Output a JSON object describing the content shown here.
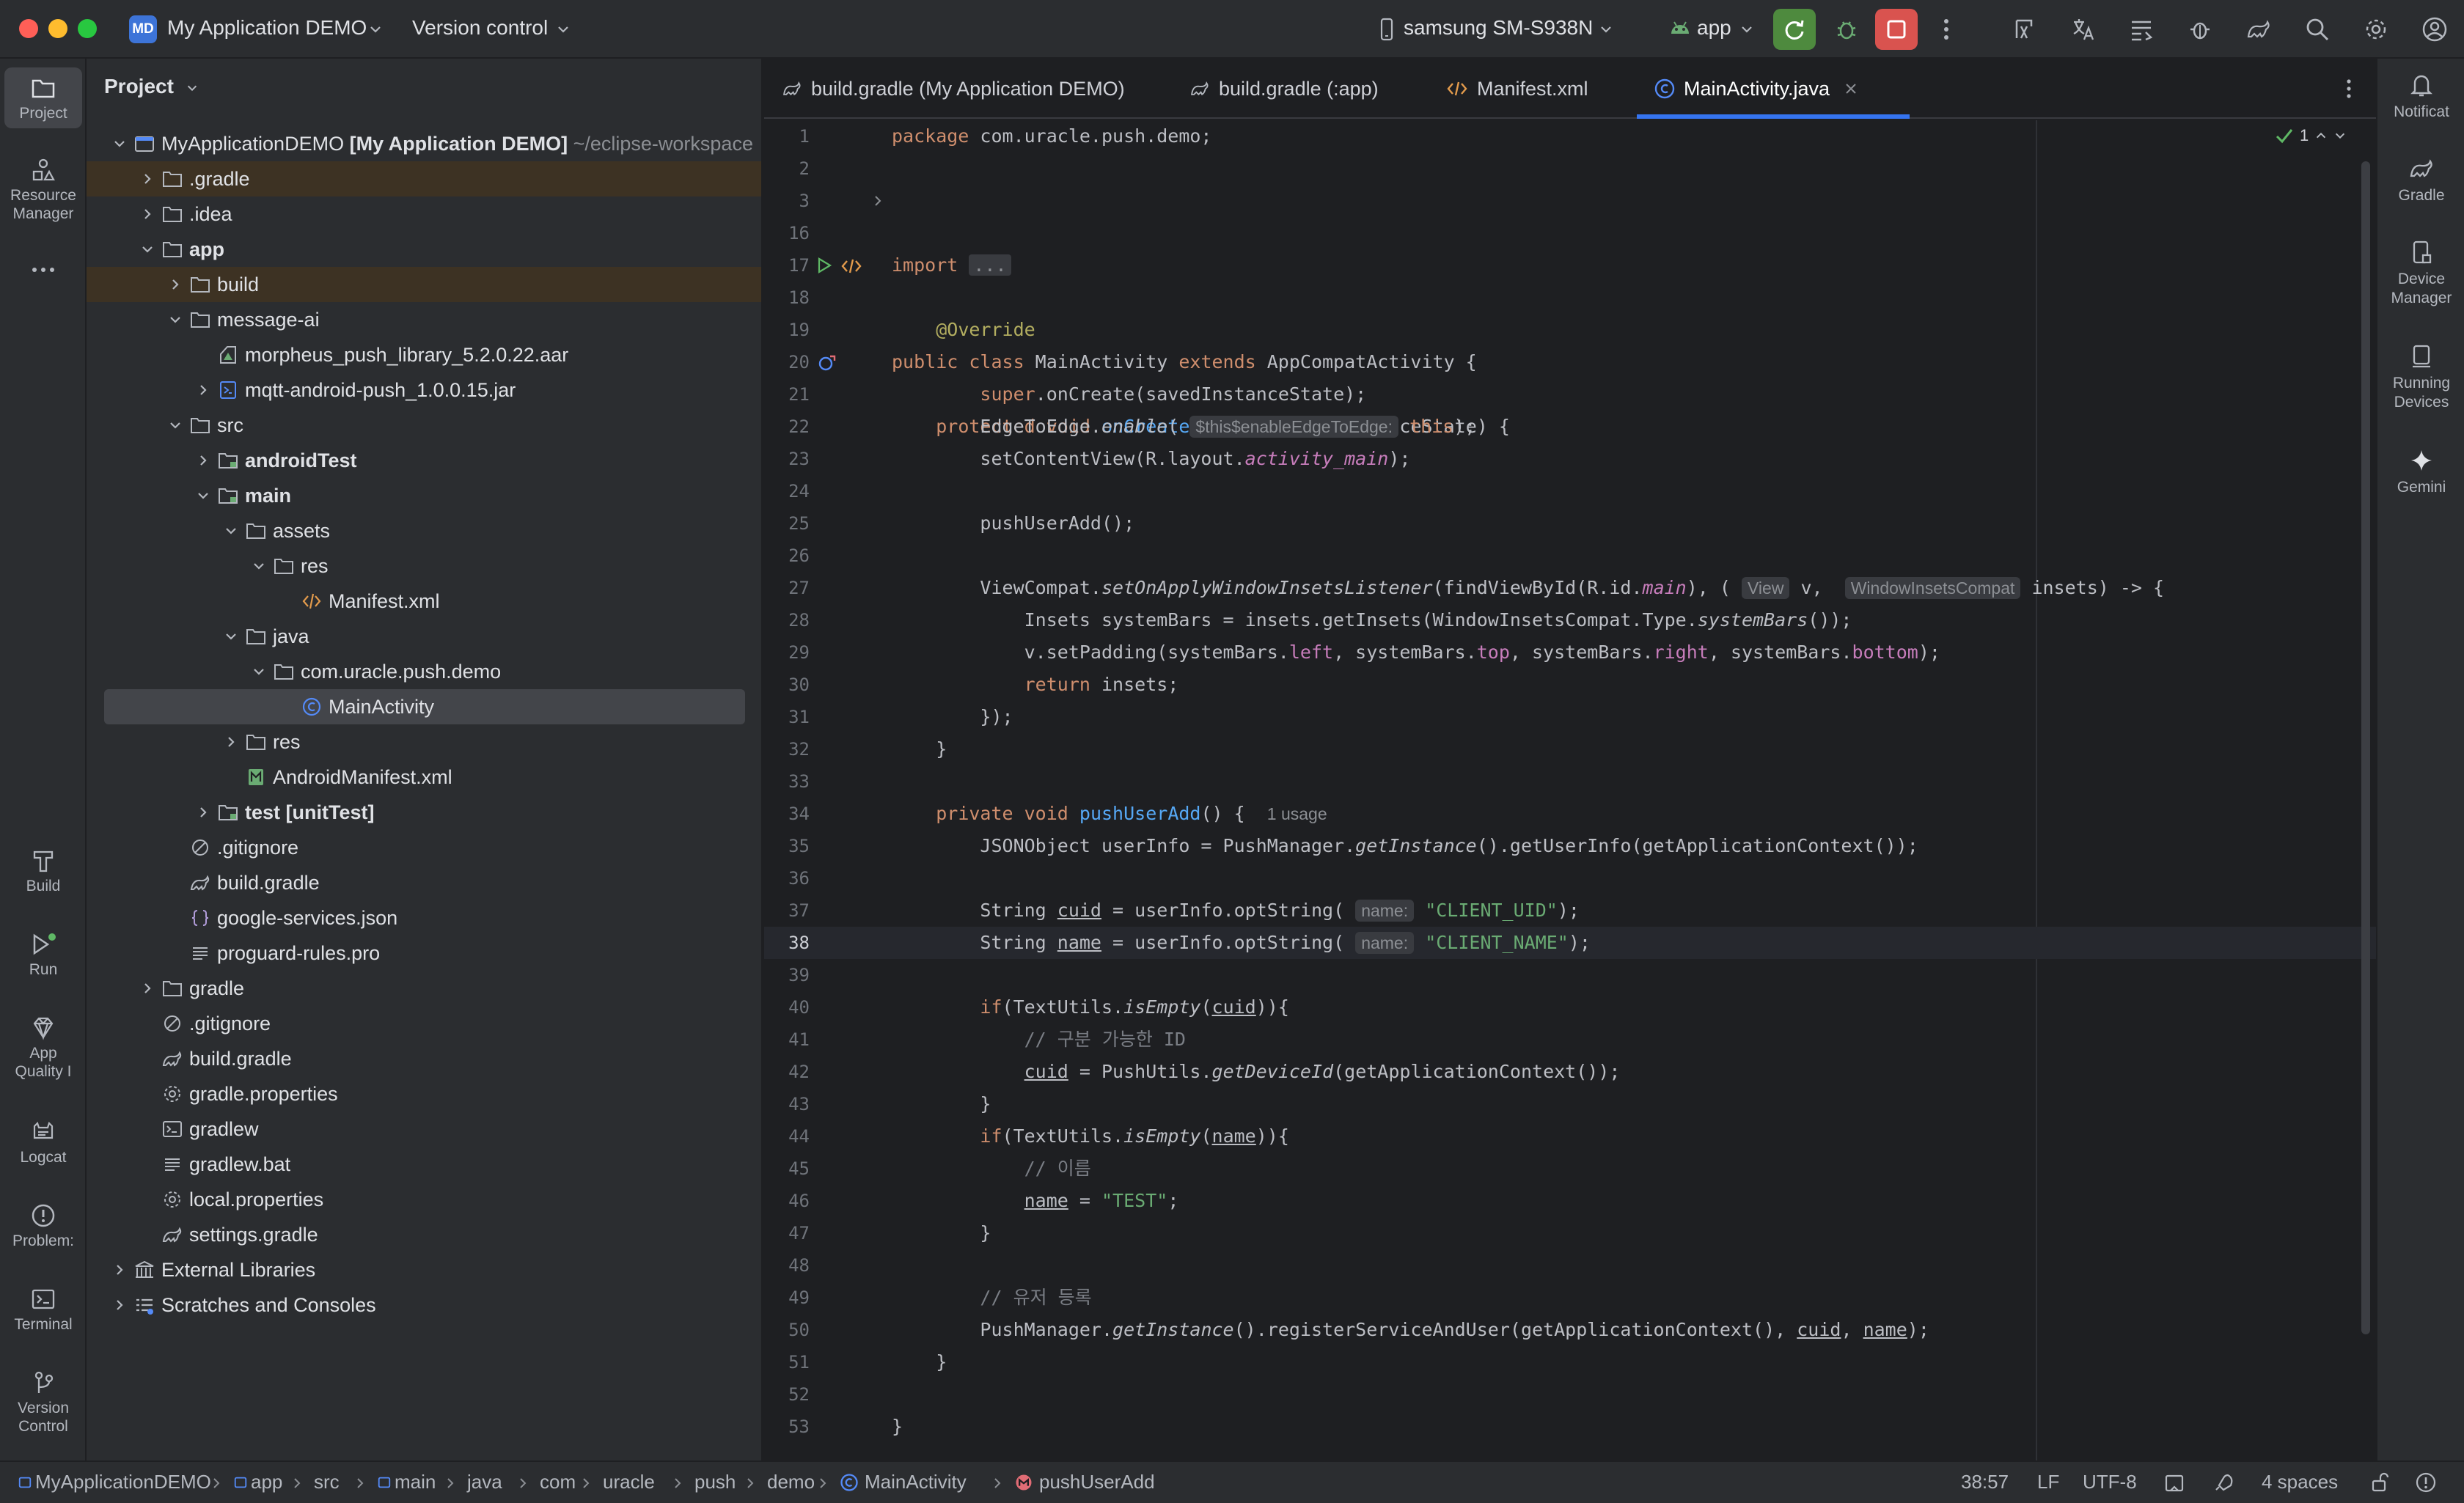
{
  "titlebar": {
    "project_badge": "MD",
    "project_name": "My Application DEMO",
    "version_control": "Version control",
    "device": "samsung SM-S938N",
    "run_config": "app"
  },
  "left_tools": {
    "project": "Project",
    "resource_manager_1": "Resource",
    "resource_manager_2": "Manager",
    "build": "Build",
    "run": "Run",
    "app_quality_1": "App",
    "app_quality_2": "Quality I",
    "logcat": "Logcat",
    "problems": "Problem:",
    "terminal": "Terminal",
    "version_control_1": "Version",
    "version_control_2": "Control"
  },
  "project_panel": {
    "title": "Project",
    "root_name": "MyApplicationDEMO",
    "root_module": "[My Application DEMO]",
    "root_path": "~/eclipse-workspace",
    "items": [
      ".gradle",
      ".idea",
      "app",
      "build",
      "message-ai",
      "morpheus_push_library_5.2.0.22.aar",
      "mqtt-android-push_1.0.0.15.jar",
      "src",
      "androidTest",
      "main",
      "assets",
      "res",
      "Manifest.xml",
      "java",
      "com.uracle.push.demo",
      "MainActivity",
      "res",
      "AndroidManifest.xml",
      "test",
      ".gitignore",
      "build.gradle",
      "google-services.json",
      "proguard-rules.pro",
      "gradle",
      ".gitignore",
      "build.gradle",
      "gradle.properties",
      "gradlew",
      "gradlew.bat",
      "local.properties",
      "settings.gradle",
      "External Libraries",
      "Scratches and Consoles"
    ],
    "test_suffix": "[unitTest]"
  },
  "tabs": [
    {
      "label": "build.gradle (My Application DEMO)"
    },
    {
      "label": "build.gradle (:app)"
    },
    {
      "label": "Manifest.xml"
    },
    {
      "label": "MainActivity.java"
    }
  ],
  "editor": {
    "inspection_count": "1",
    "line_numbers": [
      "1",
      "2",
      "3",
      "16",
      "17",
      "18",
      "19",
      "20",
      "21",
      "22",
      "23",
      "24",
      "25",
      "26",
      "27",
      "28",
      "29",
      "30",
      "31",
      "32",
      "33",
      "34",
      "35",
      "36",
      "37",
      "38",
      "39",
      "40",
      "41",
      "42",
      "43",
      "44",
      "45",
      "46",
      "47",
      "48",
      "49",
      "50",
      "51",
      "52",
      "53"
    ],
    "hint_enable": "$this$enableEdgeToEdge:",
    "hint_view": "View",
    "hint_insets": "WindowInsetsCompat",
    "hint_name1": "name:",
    "hint_name2": "name:",
    "usage": "1 usage",
    "fold": "..."
  },
  "right_tools": {
    "notifications": "Notificat",
    "gradle": "Gradle",
    "device_manager_1": "Device",
    "device_manager_2": "Manager",
    "running_devices_1": "Running",
    "running_devices_2": "Devices",
    "gemini": "Gemini"
  },
  "statusbar": {
    "breadcrumbs": [
      "MyApplicationDEMO",
      "app",
      "src",
      "main",
      "java",
      "com",
      "uracle",
      "push",
      "demo",
      "MainActivity",
      "pushUserAdd"
    ],
    "position": "38:57",
    "line_sep": "LF",
    "encoding": "UTF-8",
    "indent": "4 spaces"
  }
}
